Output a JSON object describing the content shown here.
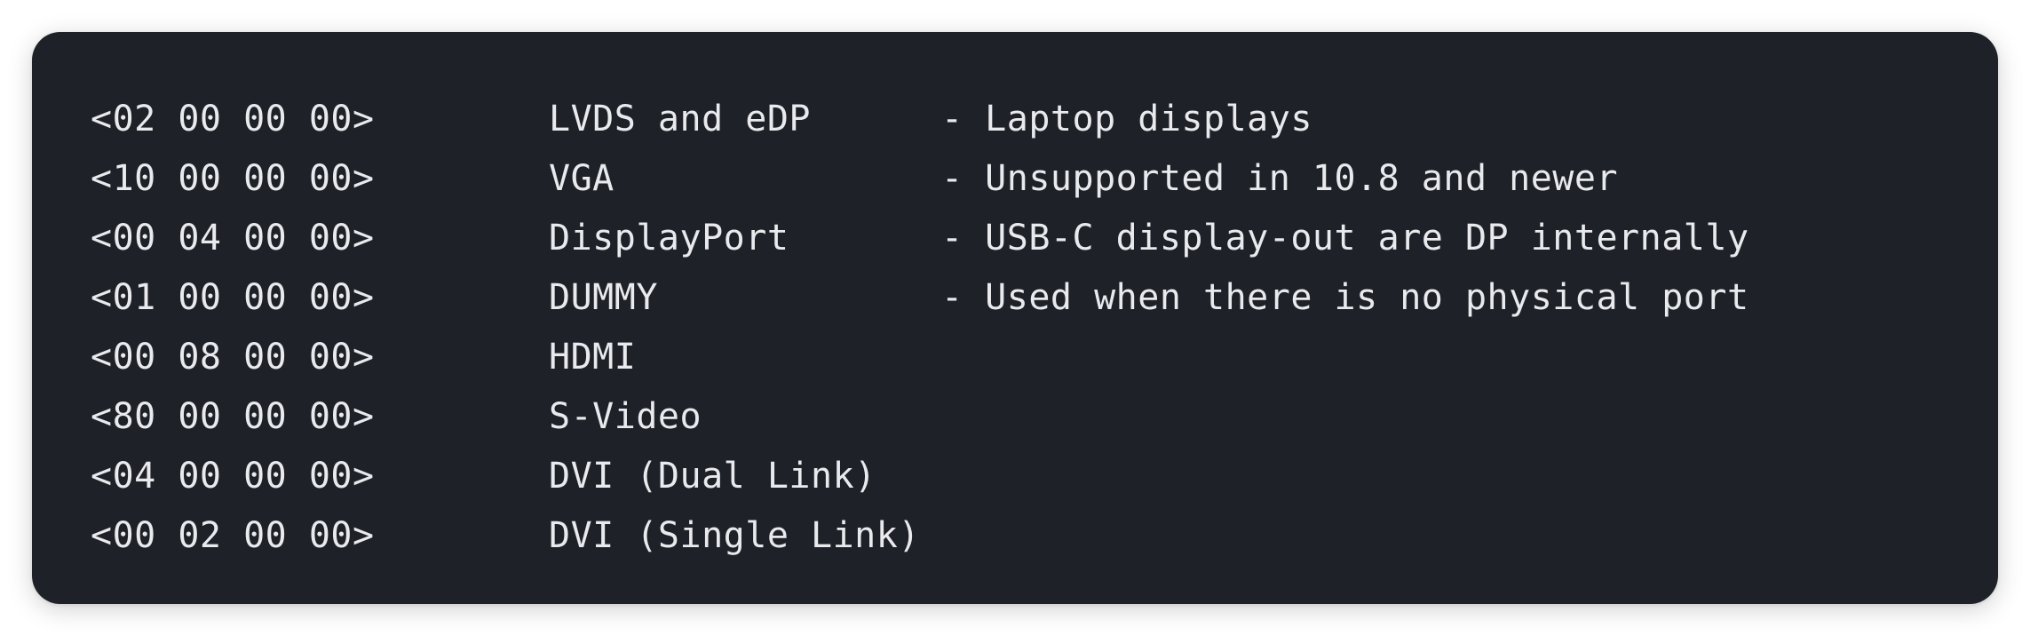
{
  "code_block": {
    "lines": [
      {
        "value": "<02 00 00 00>",
        "type": "LVDS and eDP",
        "note": "- Laptop displays"
      },
      {
        "value": "<10 00 00 00>",
        "type": "VGA",
        "note": "- Unsupported in 10.8 and newer"
      },
      {
        "value": "<00 04 00 00>",
        "type": "DisplayPort",
        "note": "- USB-C display-out are DP internally"
      },
      {
        "value": "<01 00 00 00>",
        "type": "DUMMY",
        "note": "- Used when there is no physical port"
      },
      {
        "value": "<00 08 00 00>",
        "type": "HDMI",
        "note": ""
      },
      {
        "value": "<80 00 00 00>",
        "type": "S-Video",
        "note": ""
      },
      {
        "value": "<04 00 00 00>",
        "type": "DVI (Dual Link)",
        "note": ""
      },
      {
        "value": "<00 02 00 00>",
        "type": "DVI (Single Link)",
        "note": ""
      }
    ]
  },
  "colors": {
    "background": "#1f2128",
    "text": "#e9eaed",
    "page": "#ffffff"
  }
}
